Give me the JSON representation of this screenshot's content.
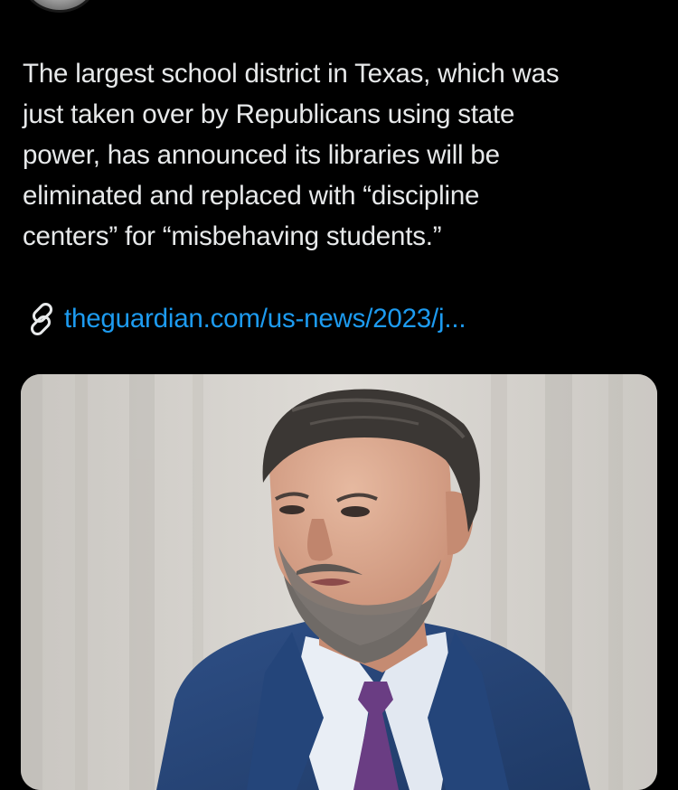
{
  "tweet": {
    "text_lines": [
      "The largest school district in Texas, which was",
      "just taken over by Republicans using state",
      "power, has announced its libraries will be",
      "eliminated and replaced with “discipline",
      "centers” for “misbehaving students.”"
    ],
    "link": {
      "icon": "link-icon",
      "text": "theguardian.com/us-news/2023/j..."
    }
  },
  "media": {
    "type": "photo",
    "icon": "photo"
  },
  "colors": {
    "background": "#000000",
    "text": "#e7e9ea",
    "link": "#1d9bf0"
  }
}
